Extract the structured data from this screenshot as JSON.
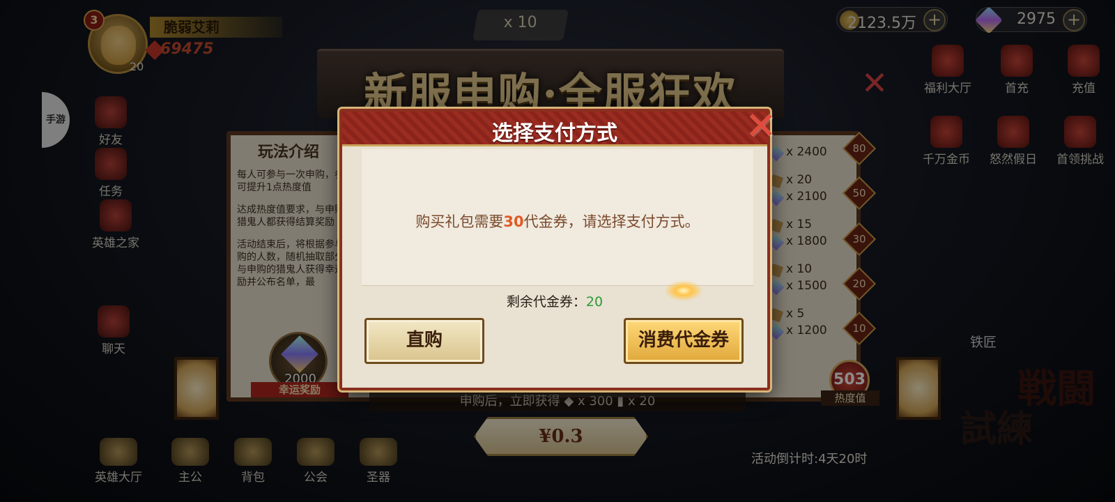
{
  "hud": {
    "player_name": "脆弱艾莉",
    "rank": "3",
    "level": "20",
    "power": "69475",
    "gold": "2123.5万",
    "gems": "2975",
    "plus": "+"
  },
  "left_tab": "手游",
  "left_menu": [
    "好友",
    "任务",
    "英雄之家",
    "聊天"
  ],
  "right_menu_top": [
    "福利大厅",
    "首充",
    "充值"
  ],
  "right_menu_mid": [
    "千万金币",
    "怒然假日",
    "首领挑战"
  ],
  "bottom_menu": [
    "英雄大厅",
    "主公",
    "背包",
    "公会",
    "圣器"
  ],
  "event": {
    "ticket_count": "x 10",
    "title": "新服申购·全服狂欢",
    "intro_title": "玩法介绍",
    "intro_paragraphs": [
      "每人可参与一次申购，参与可提升1点热度值",
      "达成热度值要求，与申购的猎鬼人都获得结算奖励",
      "活动结束后，将根据参与申购的人数，随机抽取部分参与申购的猎鬼人获得幸运奖励并公布名单，最"
    ],
    "lucky_value": "2000",
    "lucky_label": "幸运奖励",
    "tiers": [
      {
        "a": "",
        "b": "x 2400",
        "badge": "80"
      },
      {
        "a": "x 20",
        "b": "x 2100",
        "badge": "50"
      },
      {
        "a": "x 15",
        "b": "x 1800",
        "badge": "30"
      },
      {
        "a": "x 10",
        "b": "x 1500",
        "badge": "20"
      },
      {
        "a": "x 5",
        "b": "x 1200",
        "badge": "10"
      }
    ],
    "heat_value": "503",
    "heat_label": "热度值",
    "after_purchase": "申购后，立即获得 ◆ x 300 ▮ x 20",
    "price": "¥0.3",
    "countdown": "活动倒计时:4天20时",
    "smith": "铁匠",
    "battle": "戦闘",
    "trial": "試練",
    "close_glyph": "✕"
  },
  "modal": {
    "title": "选择支付方式",
    "msg_prefix": "购买礼包需要",
    "msg_amount": "30",
    "msg_suffix": "代金券，请选择支付方式。",
    "remaining_label": "剩余代金券：",
    "remaining_value": "20",
    "direct_button": "直购",
    "voucher_button": "消费代金券",
    "close_glyph": "✕"
  },
  "colors": {
    "header_red": "#9b2c21",
    "accent_orange": "#e05a24",
    "remaining_green": "#2a9a3a",
    "gold_button": "#ffd879"
  }
}
